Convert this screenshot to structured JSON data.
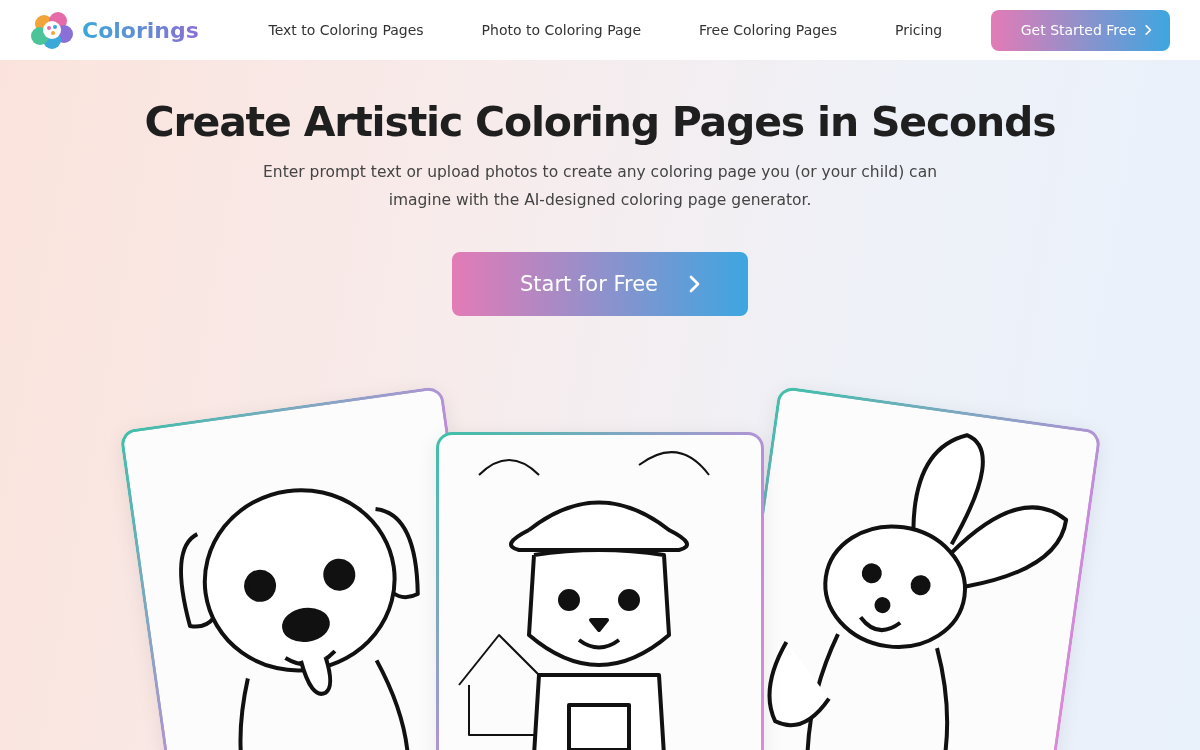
{
  "header": {
    "logo_text": "Colorings",
    "nav_links": [
      {
        "label": "Text to Coloring Pages"
      },
      {
        "label": "Photo to Coloring Page"
      },
      {
        "label": "Free Coloring Pages"
      },
      {
        "label": "Pricing"
      }
    ],
    "button": {
      "label": "Get Started Free"
    }
  },
  "hero": {
    "title": "Create Artistic Coloring Pages in Seconds",
    "subtitle": "Enter prompt text or upload photos to create any coloring page you (or your child) can imagine with the AI-designed coloring page generator.",
    "cta": {
      "label": "Start for Free"
    }
  },
  "gallery": {
    "cards": [
      {
        "kind": "puppy"
      },
      {
        "kind": "cat"
      },
      {
        "kind": "bunny"
      }
    ]
  }
}
